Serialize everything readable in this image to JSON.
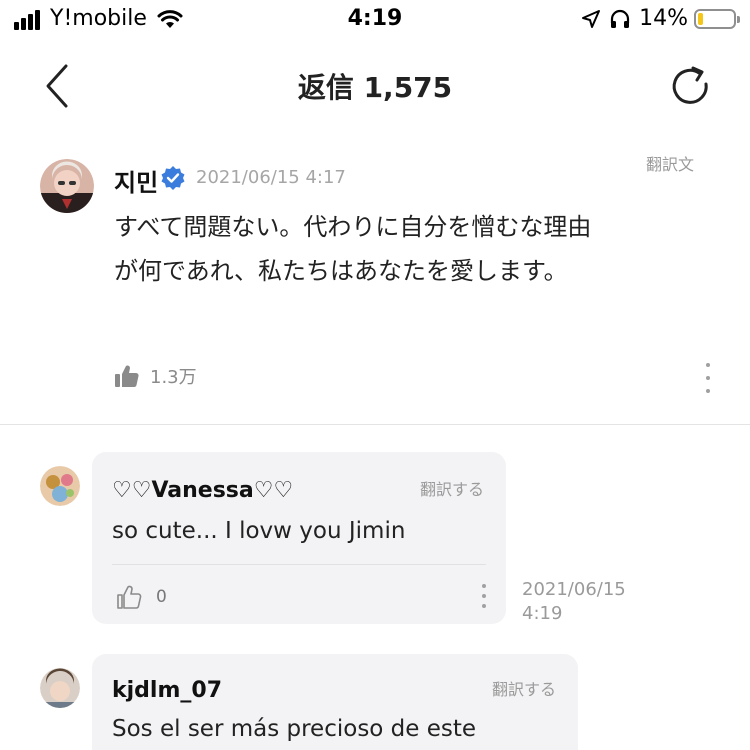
{
  "status_bar": {
    "carrier": "Y!mobile",
    "time": "4:19",
    "battery_percent": "14%",
    "battery_level": 0.14
  },
  "header": {
    "title": "返信 1,575"
  },
  "post": {
    "author": "지민",
    "timestamp": "2021/06/15 4:17",
    "translate_label": "翻訳文",
    "text": "すべて問題ない。代わりに自分を憎むな理由が何であれ、私たちはあなたを愛します。",
    "like_count": "1.3万"
  },
  "replies": [
    {
      "author": "♡♡Vanessa♡♡",
      "translate_label": "翻訳する",
      "text": "so cute... I lovw you Jimin",
      "like_count": "0",
      "timestamp_date": "2021/06/15",
      "timestamp_time": "4:19"
    },
    {
      "author": "kjdlm_07",
      "translate_label": "翻訳する",
      "text": "Sos el ser más precioso de este"
    }
  ],
  "icons": {
    "back": "chevron-left-icon",
    "refresh": "refresh-icon",
    "verified": "verified-badge-icon",
    "like": "thumbs-up-icon",
    "more": "more-vertical-icon",
    "location": "location-arrow-icon",
    "headphones": "headphones-icon",
    "wifi": "wifi-icon"
  },
  "colors": {
    "verified_blue": "#3b7ddd",
    "battery_yellow": "#f5c518",
    "muted_text": "#9a9a9a",
    "bubble_bg": "#f3f3f5"
  }
}
